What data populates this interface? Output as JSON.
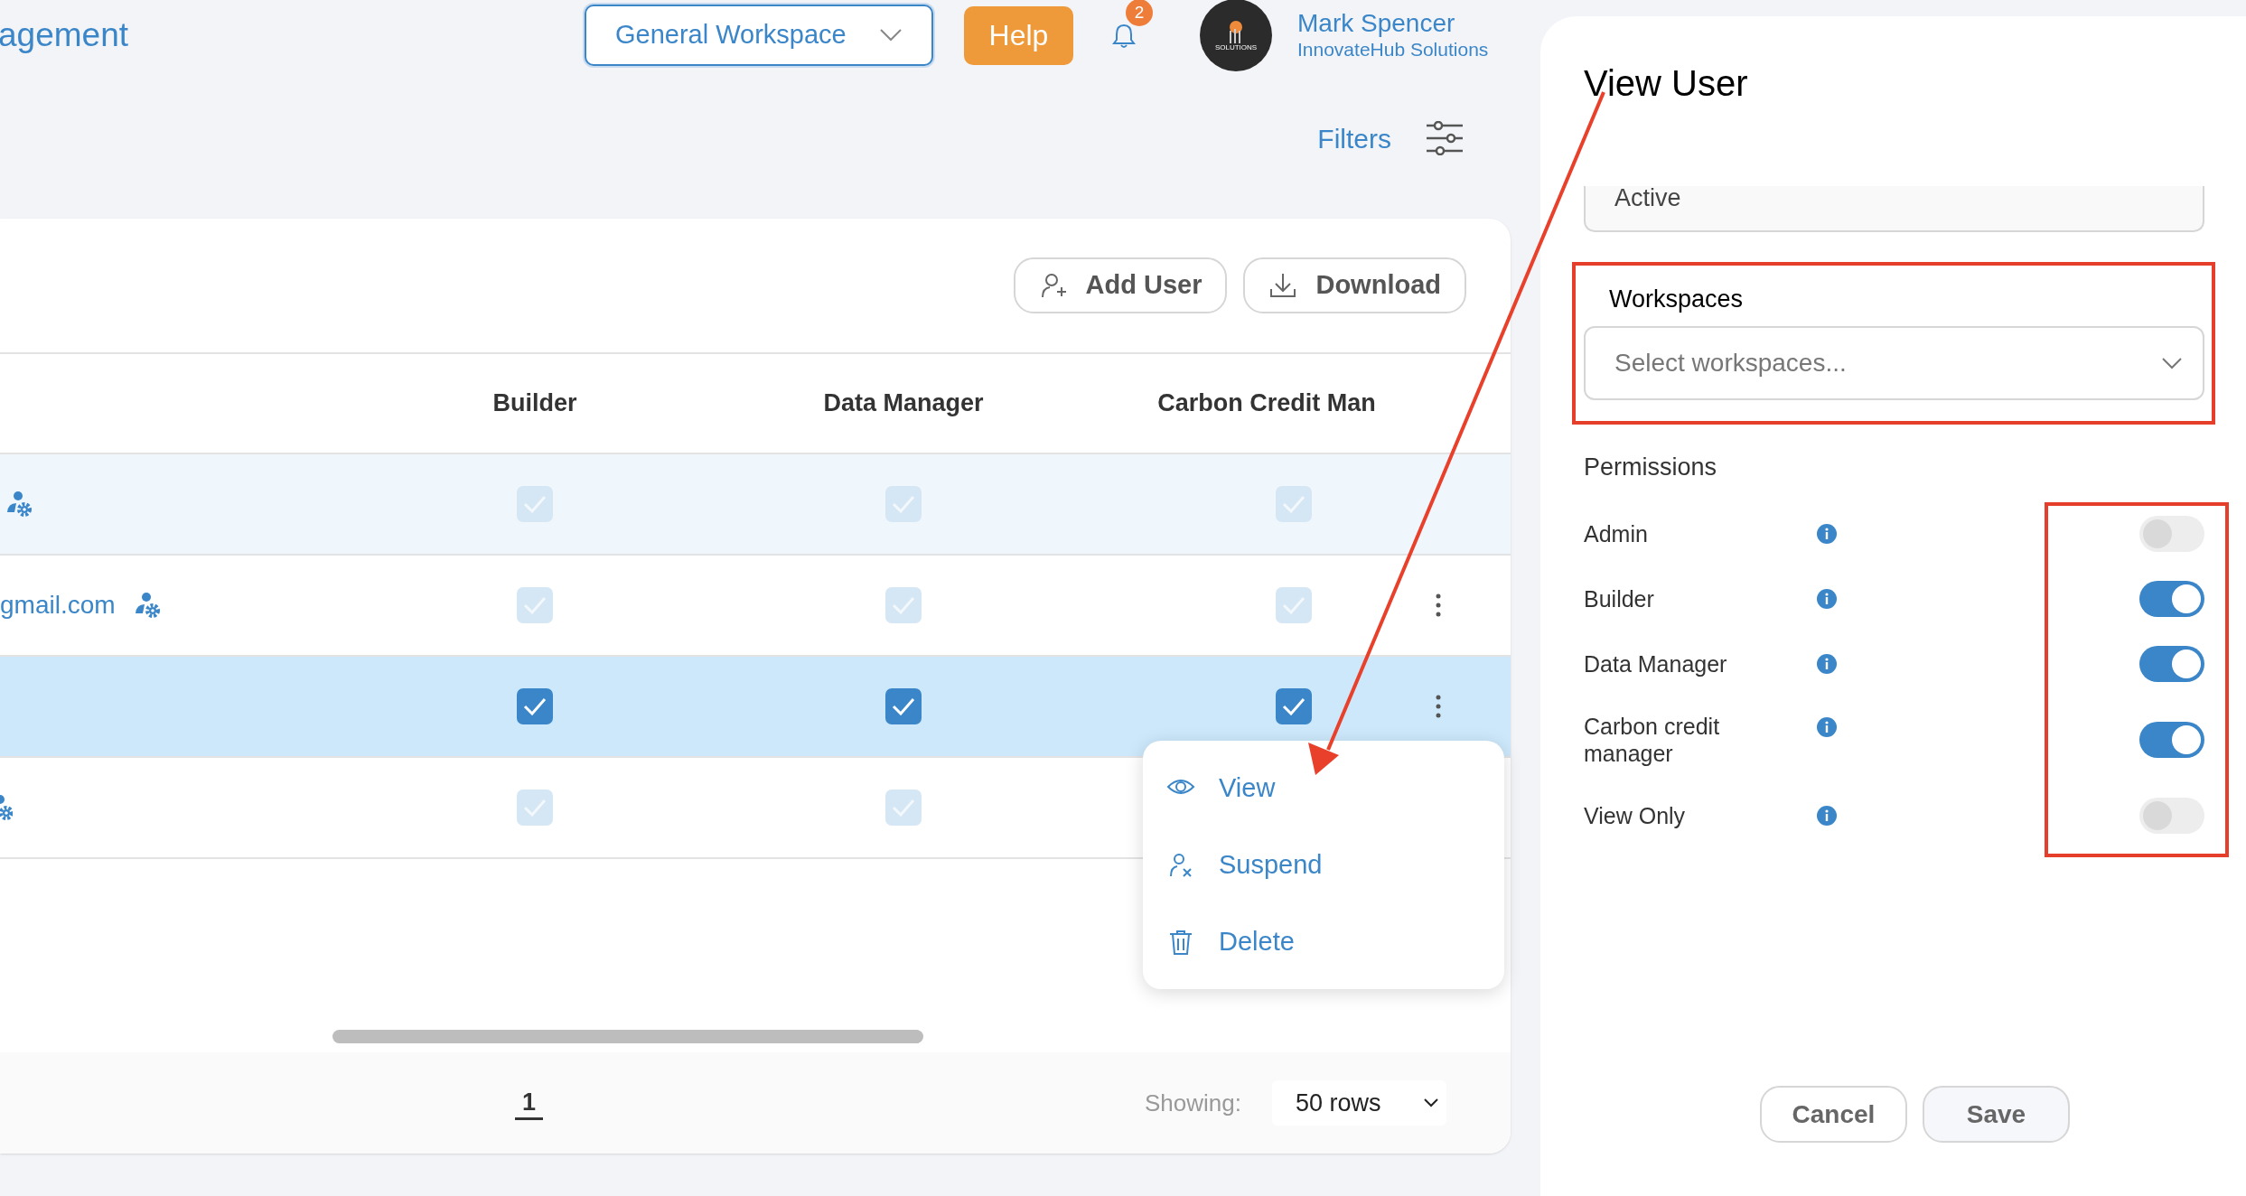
{
  "header": {
    "title": "agement",
    "workspace": "General Workspace",
    "help": "Help",
    "notification_count": "2",
    "avatar_text": "SOLUTIONS",
    "user_name": "Mark Spencer",
    "company": "InnovateHub Solutions"
  },
  "filters": "Filters",
  "toolbar": [
    {
      "kind": "add-user",
      "label": "Add User"
    },
    {
      "kind": "download",
      "label": "Download"
    }
  ],
  "table": {
    "columns": [
      "Builder",
      "Data Manager",
      "Carbon Credit Man"
    ],
    "rows": [
      {
        "kind": "admin",
        "selected": false,
        "hovered": true,
        "checks": [
          {
            "checked": true,
            "disabled": true
          },
          {
            "checked": true,
            "disabled": true
          },
          {
            "checked": true,
            "disabled": true
          }
        ],
        "menu_button": false
      },
      {
        "kind": "admin",
        "email": "gmail.com",
        "selected": false,
        "hovered": false,
        "checks": [
          {
            "checked": true,
            "disabled": true
          },
          {
            "checked": true,
            "disabled": true
          },
          {
            "checked": true,
            "disabled": true
          }
        ],
        "menu_button": true
      },
      {
        "kind": "user",
        "selected": true,
        "hovered": false,
        "checks": [
          {
            "checked": true,
            "disabled": false
          },
          {
            "checked": true,
            "disabled": false
          },
          {
            "checked": true,
            "disabled": false
          }
        ],
        "menu_button": true
      },
      {
        "kind": "admin-cut",
        "selected": false,
        "hovered": false,
        "checks": [
          {
            "checked": true,
            "disabled": true
          },
          {
            "checked": true,
            "disabled": true
          }
        ],
        "menu_button": false
      }
    ]
  },
  "row_menu": [
    {
      "kind": "view",
      "label": "View"
    },
    {
      "kind": "suspend",
      "label": "Suspend"
    },
    {
      "kind": "delete",
      "label": "Delete"
    }
  ],
  "pagination": {
    "page": "1",
    "showing_label": "Showing:",
    "rows_per_page": "50 rows"
  },
  "panel": {
    "title": "View User",
    "status_value": "Active",
    "workspaces_label": "Workspaces",
    "workspaces_placeholder": "Select workspaces...",
    "permissions_heading": "Permissions",
    "permissions": [
      {
        "label": "Admin",
        "on": false
      },
      {
        "label": "Builder",
        "on": true
      },
      {
        "label": "Data Manager",
        "on": true
      },
      {
        "label": "Carbon credit manager",
        "on": true
      },
      {
        "label": "View Only",
        "on": false
      }
    ],
    "buttons": [
      {
        "kind": "cancel",
        "label": "Cancel"
      },
      {
        "kind": "save",
        "label": "Save"
      }
    ]
  }
}
